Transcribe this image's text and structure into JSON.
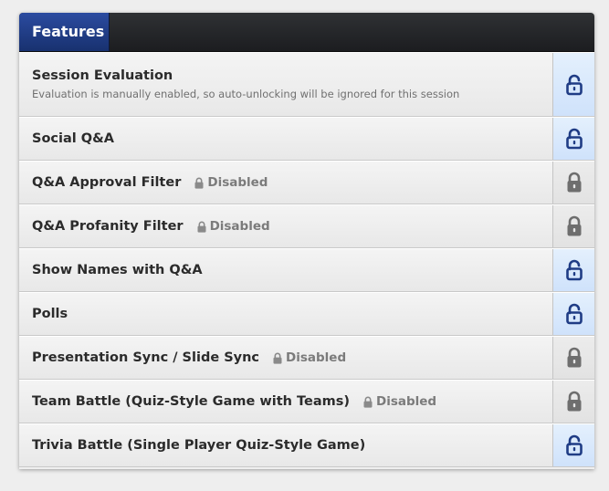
{
  "header": {
    "tab_label": "Features"
  },
  "colors": {
    "tab_blue": "#1f3c85",
    "unlocked_icon": "#1f3c85",
    "locked_icon": "#6e6e6e",
    "unlocked_bg": "#d7e8fc"
  },
  "disabled_label": "Disabled",
  "features": [
    {
      "title": "Session Evaluation",
      "subtitle": "Evaluation is manually enabled, so auto-unlocking will be ignored for this session",
      "state": "unlocked",
      "icon": "unlocked-lock-icon"
    },
    {
      "title": "Social Q&A",
      "state": "unlocked",
      "icon": "unlocked-lock-icon"
    },
    {
      "title": "Q&A Approval Filter",
      "status": "Disabled",
      "state": "locked",
      "icon": "locked-lock-icon"
    },
    {
      "title": "Q&A Profanity Filter",
      "status": "Disabled",
      "state": "locked",
      "icon": "locked-lock-icon"
    },
    {
      "title": "Show Names with Q&A",
      "state": "unlocked",
      "icon": "unlocked-lock-icon"
    },
    {
      "title": "Polls",
      "state": "unlocked",
      "icon": "unlocked-lock-icon"
    },
    {
      "title": "Presentation Sync / Slide Sync",
      "status": "Disabled",
      "state": "locked",
      "icon": "locked-lock-icon"
    },
    {
      "title": "Team Battle (Quiz-Style Game with Teams)",
      "status": "Disabled",
      "state": "locked",
      "icon": "locked-lock-icon"
    },
    {
      "title": "Trivia Battle (Single Player Quiz-Style Game)",
      "state": "unlocked",
      "icon": "unlocked-lock-icon"
    }
  ]
}
